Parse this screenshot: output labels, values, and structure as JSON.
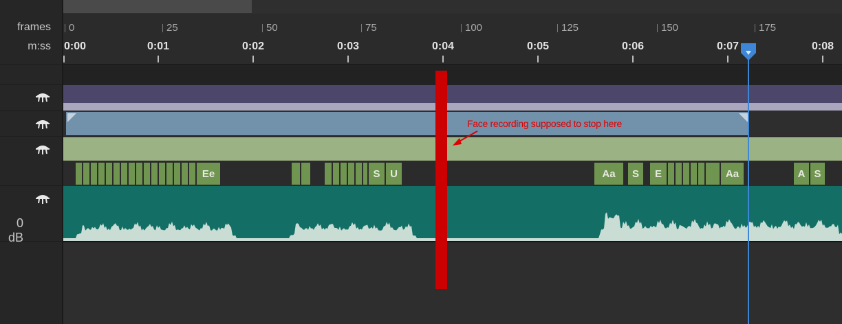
{
  "ruler": {
    "frames_label": "frames",
    "time_label": "m:ss",
    "frame_marks": [
      "0",
      "25",
      "50",
      "75",
      "100",
      "125",
      "150",
      "175"
    ],
    "time_marks": [
      "0:00",
      "0:01",
      "0:02",
      "0:03",
      "0:04",
      "0:05",
      "0:06",
      "0:07",
      "0:08"
    ]
  },
  "tracks": {
    "icon": "puppet-track-icon",
    "visemes": [
      "",
      "",
      "",
      "",
      "",
      "",
      "",
      "",
      "",
      "",
      "",
      "",
      "",
      "",
      "",
      "",
      "Ee",
      "",
      "",
      "",
      "",
      "",
      "",
      "",
      "",
      "S",
      "U",
      "Aa",
      "S",
      "E",
      "",
      "",
      "",
      "",
      "",
      "",
      "Aa",
      "A",
      "S"
    ],
    "audio_level_label": "0 dB"
  },
  "playhead": {
    "time": "0:07",
    "color": "#3d87d6"
  },
  "annotation": {
    "text": "Face recording supposed to stop here",
    "color": "#cc0000"
  },
  "colors": {
    "purple_track": "#4c466b",
    "blue_track": "#7291ab",
    "green_track": "#9bb384",
    "viseme": "#6f9550",
    "audio_track": "#136f66",
    "waveform": "#c9ddd5"
  }
}
